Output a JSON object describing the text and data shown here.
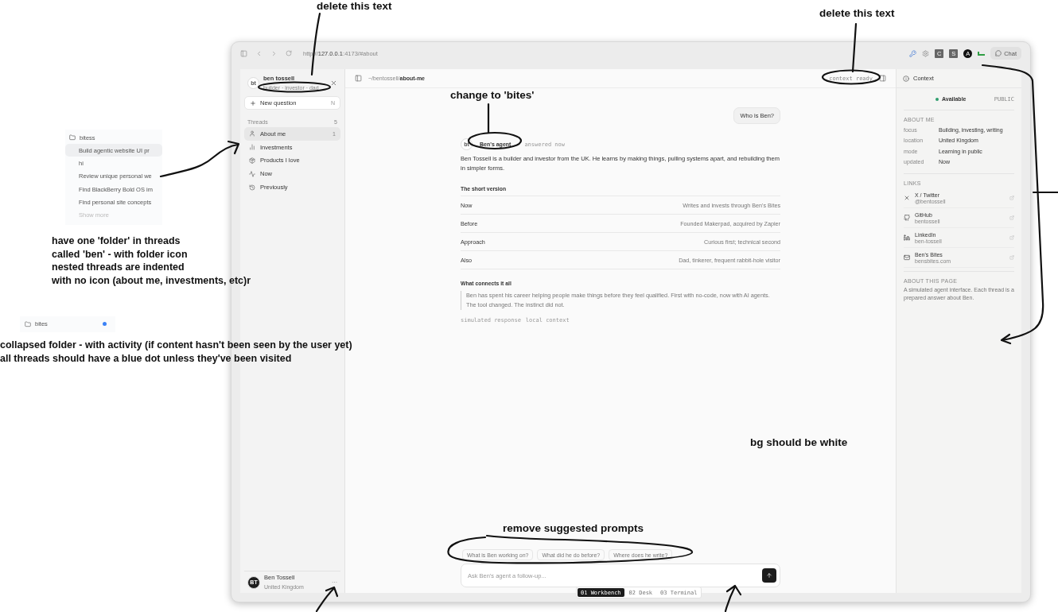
{
  "mockups": {
    "expanded_folder": {
      "name": "bitess",
      "threads": [
        {
          "label": "Build agentic website UI pr",
          "selected": true
        },
        {
          "label": "hi",
          "selected": false
        },
        {
          "label": "Review unique personal we",
          "selected": false
        },
        {
          "label": "Find BlackBerry Bold OS im",
          "selected": false
        },
        {
          "label": "Find personal site concepts",
          "selected": false
        }
      ],
      "show_more": "Show more"
    },
    "collapsed_folder": {
      "name": "bites",
      "unread": true
    }
  },
  "browser": {
    "url": {
      "scheme": "http://",
      "host": "127.0.0.1",
      "path": ":4173/#about"
    },
    "extensions": [
      {
        "kind": "password"
      },
      {
        "kind": "gear"
      },
      {
        "kind": "square",
        "label": "C"
      },
      {
        "kind": "square",
        "label": "S"
      },
      {
        "kind": "circle",
        "label": "A"
      },
      {
        "kind": "bar"
      }
    ],
    "chat_button": "Chat"
  },
  "sidebar": {
    "avatar": "bt",
    "name": "ben tossell",
    "tagline": "builder · investor · dad",
    "new_question": "New question",
    "shortcut": "N",
    "threads_label": "Threads",
    "threads_count": "5",
    "threads": [
      {
        "label": "About me",
        "count": "1",
        "selected": true
      },
      {
        "label": "Investments",
        "selected": false
      },
      {
        "label": "Products I love",
        "selected": false
      },
      {
        "label": "Now",
        "selected": false
      },
      {
        "label": "Previously",
        "selected": false
      }
    ],
    "user": {
      "avatar": "BT",
      "name": "Ben Tossell",
      "location": "United Kingdom",
      "menu": "···"
    }
  },
  "main": {
    "breadcrumb": {
      "path": "~/bentossell/",
      "page": "about-me"
    },
    "status": "context ready",
    "question": "Who is Ben?",
    "answer": {
      "avatar": "bt",
      "author": "Ben's agent",
      "time": "answered now",
      "intro": "Ben Tossell is a builder and investor from the UK. He learns by making things, pulling systems apart, and rebuilding them in simpler forms.",
      "summary_title": "The short version",
      "summary": [
        {
          "label": "Now",
          "value": "Writes and invests through Ben's Bites"
        },
        {
          "label": "Before",
          "value": "Founded Makerpad, acquired by Zapier"
        },
        {
          "label": "Approach",
          "value": "Curious first; technical second"
        },
        {
          "label": "Also",
          "value": "Dad, tinkerer, frequent rabbit-hole visitor"
        }
      ],
      "connection_title": "What connects it all",
      "quote": "Ben has spent his career helping people make things before they feel qualified. First with no-code, now with AI agents. The tool changed. The instinct did not.",
      "tags": [
        "simulated response",
        "local context"
      ]
    },
    "suggestions": [
      "What is Ben working on?",
      "What did he do before?",
      "Where does he write?"
    ],
    "input": {
      "placeholder": "Ask Ben's agent a follow-up..."
    },
    "modes": [
      {
        "label": "01 Workbench",
        "selected": true
      },
      {
        "label": "02 Desk",
        "selected": false
      },
      {
        "label": "03 Terminal",
        "selected": false
      }
    ]
  },
  "context": {
    "title": "Context",
    "status": {
      "label": "Available",
      "online": true
    },
    "visibility": "PUBLIC",
    "about_title": "ABOUT ME",
    "about": [
      {
        "key": "focus",
        "value": "Building, investing, writing"
      },
      {
        "key": "location",
        "value": "United Kingdom"
      },
      {
        "key": "mode",
        "value": "Learning in public"
      },
      {
        "key": "updated",
        "value": "Now"
      }
    ],
    "links_title": "LINKS",
    "links": [
      {
        "name": "X / Twitter",
        "handle": "@bentossell"
      },
      {
        "name": "GitHub",
        "handle": "bentossell"
      },
      {
        "name": "LinkedIn",
        "handle": "ben-tossell"
      },
      {
        "name": "Ben's Bites",
        "handle": "bensbites.com"
      }
    ],
    "page_title": "ABOUT THIS PAGE",
    "page_text": "A simulated agent interface. Each thread is a prepared answer about Ben."
  },
  "annotations": [
    {
      "lines": [
        "delete this text"
      ]
    },
    {
      "lines": [
        "delete this text"
      ]
    },
    {
      "lines": [
        "change to 'bites'"
      ]
    },
    {
      "lines": [
        "have one 'folder' in threads",
        "called 'ben' - with folder icon",
        "nested threads are indented",
        "with no icon (about me, investments, etc)r"
      ]
    },
    {
      "lines": [
        "collapsed folder - with activity (if content hasn't been seen by the user yet)",
        "all threads should have a blue dot unless they've been visited"
      ]
    },
    {
      "lines": [
        "bg should be white"
      ]
    },
    {
      "lines": [
        "remove suggested prompts"
      ]
    }
  ]
}
